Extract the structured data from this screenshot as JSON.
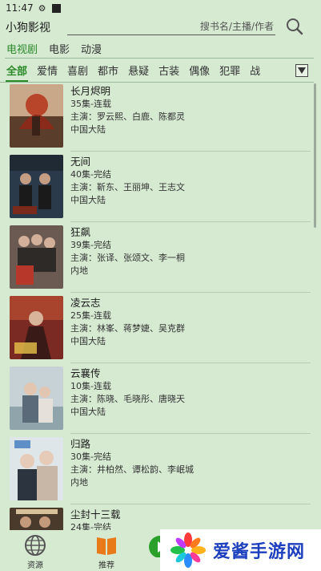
{
  "status_bar": {
    "time": "11:47"
  },
  "app": {
    "title": "小狗影视"
  },
  "search": {
    "placeholder": "搜书名/主播/作者"
  },
  "category_tabs": [
    {
      "label": "电视剧",
      "active": true
    },
    {
      "label": "电影",
      "active": false
    },
    {
      "label": "动漫",
      "active": false
    }
  ],
  "genres": [
    {
      "label": "全部",
      "active": true
    },
    {
      "label": "爱情"
    },
    {
      "label": "喜剧"
    },
    {
      "label": "都市"
    },
    {
      "label": "悬疑"
    },
    {
      "label": "古装"
    },
    {
      "label": "偶像"
    },
    {
      "label": "犯罪"
    },
    {
      "label": "战"
    }
  ],
  "shows": [
    {
      "title": "长月烬明",
      "episodes": "35集-连载",
      "cast": "主演：罗云熙、白鹿、陈都灵",
      "region": "中国大陆"
    },
    {
      "title": "无间",
      "episodes": "40集-完结",
      "cast": "主演：靳东、王丽坤、王志文",
      "region": "中国大陆"
    },
    {
      "title": "狂飙",
      "episodes": "39集-完结",
      "cast": "主演：张译、张颂文、李一桐",
      "region": "内地"
    },
    {
      "title": "凌云志",
      "episodes": "25集-连载",
      "cast": "主演：林峯、蒋梦婕、吴克群",
      "region": "中国大陆"
    },
    {
      "title": "云襄传",
      "episodes": "10集-连载",
      "cast": "主演：陈晓、毛晓彤、唐晓天",
      "region": "中国大陆"
    },
    {
      "title": "归路",
      "episodes": "30集-完结",
      "cast": "主演：井柏然、谭松韵、李岷城",
      "region": "内地"
    },
    {
      "title": "尘封十三载",
      "episodes": "24集-完结",
      "cast": "",
      "region": ""
    }
  ],
  "bottom_nav": [
    {
      "label": "资源",
      "icon": "globe-icon"
    },
    {
      "label": "推荐",
      "icon": "book-icon"
    },
    {
      "label": "",
      "icon": "play-icon"
    }
  ],
  "watermark": {
    "text": "爱酱手游网"
  },
  "colors": {
    "background": "#d6ead2",
    "accent": "#2a8a2a",
    "watermark_text": "#1d3fbe"
  }
}
